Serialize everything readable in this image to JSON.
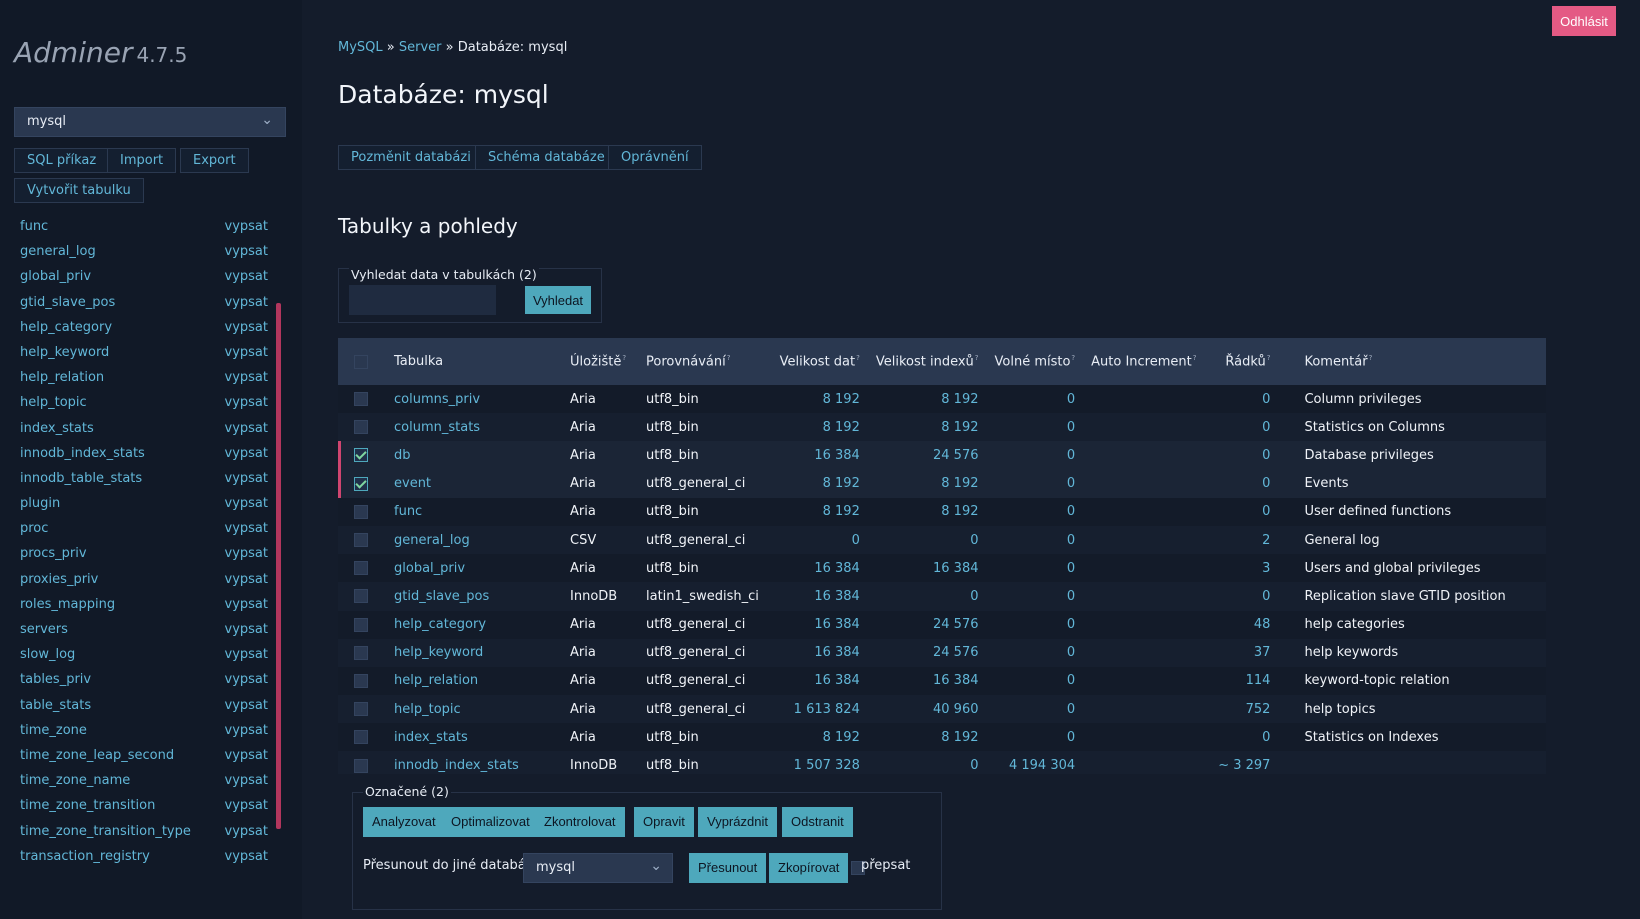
{
  "app": {
    "name": "Adminer",
    "version": "4.7.5"
  },
  "sidebar": {
    "selected_db": "mysql",
    "buttons": {
      "sql": "SQL příkaz",
      "import": "Import",
      "export": "Export",
      "create_table": "Vytvořit tabulku"
    },
    "select_label": "vypsat",
    "tables": [
      "func",
      "general_log",
      "global_priv",
      "gtid_slave_pos",
      "help_category",
      "help_keyword",
      "help_relation",
      "help_topic",
      "index_stats",
      "innodb_index_stats",
      "innodb_table_stats",
      "plugin",
      "proc",
      "procs_priv",
      "proxies_priv",
      "roles_mapping",
      "servers",
      "slow_log",
      "tables_priv",
      "table_stats",
      "time_zone",
      "time_zone_leap_second",
      "time_zone_name",
      "time_zone_transition",
      "time_zone_transition_type",
      "transaction_registry"
    ]
  },
  "header": {
    "logout": "Odhlásit",
    "breadcrumb": {
      "mysql": "MySQL",
      "sep1": " » ",
      "server": "Server",
      "sep2": " » ",
      "current": "Databáze: mysql"
    },
    "title": "Databáze: mysql",
    "actions": {
      "alter": "Pozměnit databázi",
      "schema": "Schéma databáze",
      "privileges": "Oprávnění"
    }
  },
  "section": {
    "title": "Tabulky a pohledy"
  },
  "search": {
    "legend": "Vyhledat data v tabulkách (2)",
    "button": "Vyhledat",
    "value": ""
  },
  "table": {
    "columns": {
      "table": "Tabulka",
      "engine": "Úložiště",
      "collation": "Porovnávání",
      "data_length": "Velikost dat",
      "index_length": "Velikost indexů",
      "data_free": "Volné místo",
      "auto_increment": "Auto Increment",
      "rows": "Řádků",
      "comment": "Komentář"
    },
    "rows": [
      {
        "name": "columns_priv",
        "engine": "Aria",
        "collation": "utf8_bin",
        "data": "8 192",
        "index": "8 192",
        "free": "0",
        "auto_inc": "",
        "rows": "0",
        "comment": "Column privileges",
        "checked": false
      },
      {
        "name": "column_stats",
        "engine": "Aria",
        "collation": "utf8_bin",
        "data": "8 192",
        "index": "8 192",
        "free": "0",
        "auto_inc": "",
        "rows": "0",
        "comment": "Statistics on Columns",
        "checked": false
      },
      {
        "name": "db",
        "engine": "Aria",
        "collation": "utf8_bin",
        "data": "16 384",
        "index": "24 576",
        "free": "0",
        "auto_inc": "",
        "rows": "0",
        "comment": "Database privileges",
        "checked": true
      },
      {
        "name": "event",
        "engine": "Aria",
        "collation": "utf8_general_ci",
        "data": "8 192",
        "index": "8 192",
        "free": "0",
        "auto_inc": "",
        "rows": "0",
        "comment": "Events",
        "checked": true
      },
      {
        "name": "func",
        "engine": "Aria",
        "collation": "utf8_bin",
        "data": "8 192",
        "index": "8 192",
        "free": "0",
        "auto_inc": "",
        "rows": "0",
        "comment": "User defined functions",
        "checked": false
      },
      {
        "name": "general_log",
        "engine": "CSV",
        "collation": "utf8_general_ci",
        "data": "0",
        "index": "0",
        "free": "0",
        "auto_inc": "",
        "rows": "2",
        "comment": "General log",
        "checked": false
      },
      {
        "name": "global_priv",
        "engine": "Aria",
        "collation": "utf8_bin",
        "data": "16 384",
        "index": "16 384",
        "free": "0",
        "auto_inc": "",
        "rows": "3",
        "comment": "Users and global privileges",
        "checked": false
      },
      {
        "name": "gtid_slave_pos",
        "engine": "InnoDB",
        "collation": "latin1_swedish_ci",
        "data": "16 384",
        "index": "0",
        "free": "0",
        "auto_inc": "",
        "rows": "0",
        "comment": "Replication slave GTID position",
        "checked": false
      },
      {
        "name": "help_category",
        "engine": "Aria",
        "collation": "utf8_general_ci",
        "data": "16 384",
        "index": "24 576",
        "free": "0",
        "auto_inc": "",
        "rows": "48",
        "comment": "help categories",
        "checked": false
      },
      {
        "name": "help_keyword",
        "engine": "Aria",
        "collation": "utf8_general_ci",
        "data": "16 384",
        "index": "24 576",
        "free": "0",
        "auto_inc": "",
        "rows": "37",
        "comment": "help keywords",
        "checked": false
      },
      {
        "name": "help_relation",
        "engine": "Aria",
        "collation": "utf8_general_ci",
        "data": "16 384",
        "index": "16 384",
        "free": "0",
        "auto_inc": "",
        "rows": "114",
        "comment": "keyword-topic relation",
        "checked": false
      },
      {
        "name": "help_topic",
        "engine": "Aria",
        "collation": "utf8_general_ci",
        "data": "1 613 824",
        "index": "40 960",
        "free": "0",
        "auto_inc": "",
        "rows": "752",
        "comment": "help topics",
        "checked": false
      },
      {
        "name": "index_stats",
        "engine": "Aria",
        "collation": "utf8_bin",
        "data": "8 192",
        "index": "8 192",
        "free": "0",
        "auto_inc": "",
        "rows": "0",
        "comment": "Statistics on Indexes",
        "checked": false
      },
      {
        "name": "innodb_index_stats",
        "engine": "InnoDB",
        "collation": "utf8_bin",
        "data": "1 507 328",
        "index": "0",
        "free": "4 194 304",
        "auto_inc": "",
        "rows": "~ 3 297",
        "comment": "",
        "checked": false
      }
    ]
  },
  "bulk": {
    "legend": "Označené (2)",
    "actions": {
      "analyze": "Analyzovat",
      "optimize": "Optimalizovat",
      "check": "Zkontrolovat",
      "repair": "Opravit",
      "truncate": "Vyprázdnit",
      "drop": "Odstranit"
    },
    "move_label": "Přesunout do jiné databáze:",
    "target_db": "mysql",
    "move": "Přesunout",
    "copy": "Zkopírovat",
    "overwrite": "přepsat"
  }
}
